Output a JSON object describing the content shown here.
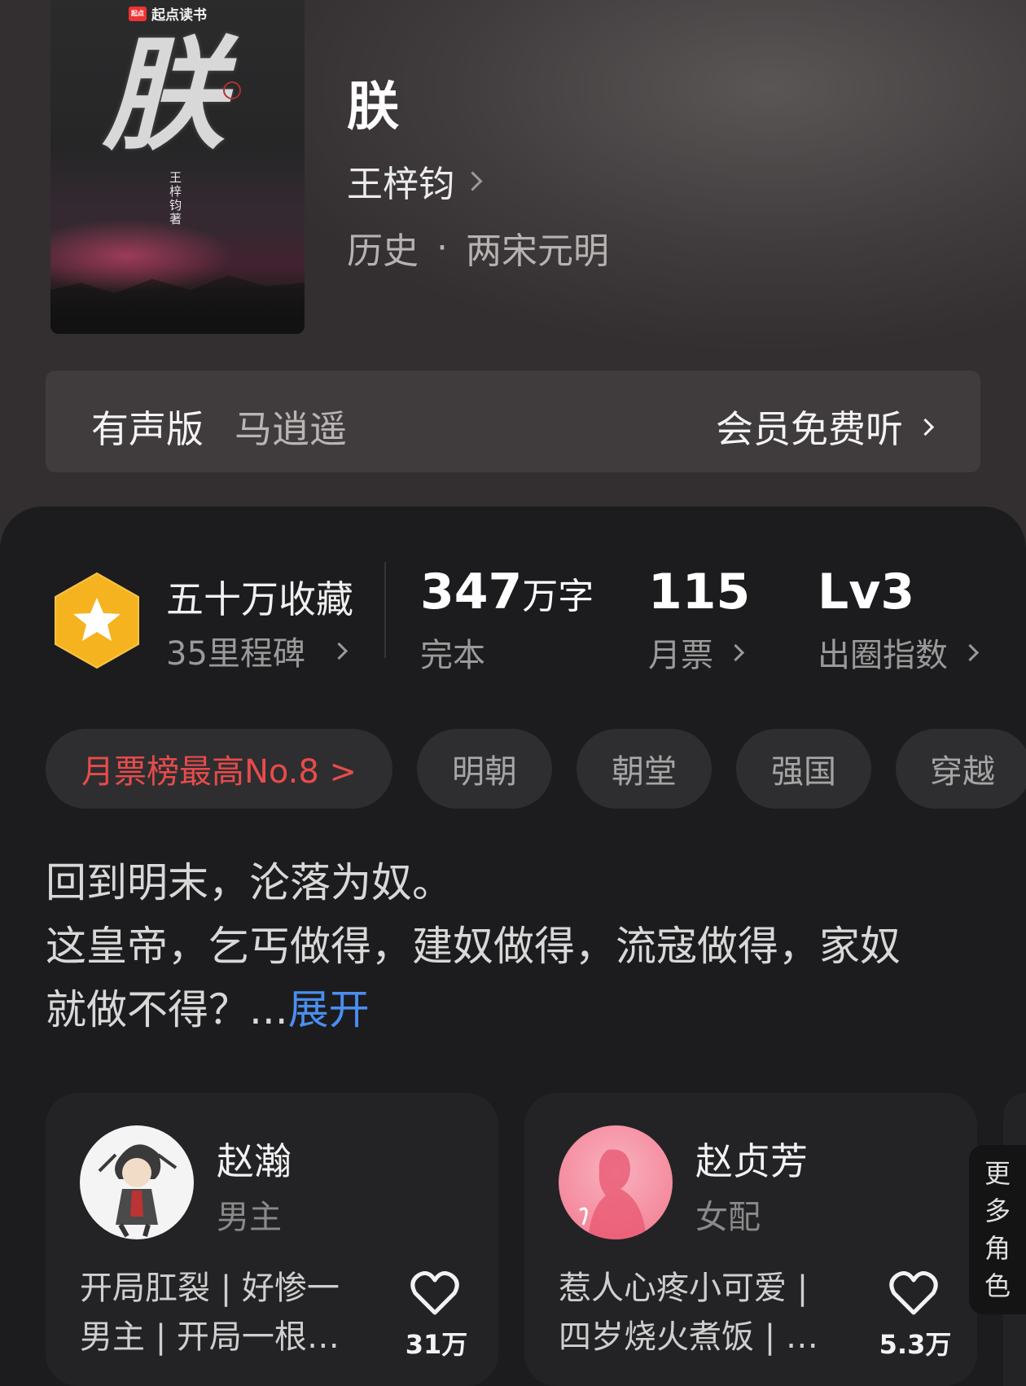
{
  "cover": {
    "brand": "起点读书",
    "brand_logo": "起点",
    "title": "朕",
    "author_vertical": "王梓钧著"
  },
  "book": {
    "title": "朕",
    "author": "王梓钧",
    "genre": "历史",
    "genre_separator": "·",
    "subgenre": "两宋元明"
  },
  "audio": {
    "label": "有声版",
    "narrator": "马逍遥",
    "cta": "会员免费听"
  },
  "stats": {
    "collect_title": "五十万收藏",
    "collect_sub": "35里程碑",
    "words_num": "347",
    "words_unit": "万字",
    "words_label": "完本",
    "tickets_num": "115",
    "tickets_label": "月票",
    "circle_num": "Lv3",
    "circle_label": "出圈指数"
  },
  "tags": [
    "月票榜最高No.8 >",
    "明朝",
    "朝堂",
    "强国",
    "穿越"
  ],
  "synopsis": {
    "line1": "回到明末，沦落为奴。",
    "line2": "这皇帝，乞丐做得，建奴做得，流寇做得，家奴",
    "line3": "就做不得？...",
    "expand": "展开"
  },
  "characters": [
    {
      "name": "赵瀚",
      "role": "男主",
      "desc1": "开局肛裂 | 好惨一",
      "desc2": "男主 | 开局一根…",
      "likes": "31万"
    },
    {
      "name": "赵贞芳",
      "role": "女配",
      "desc1": "惹人心疼小可爱 |",
      "desc2": "四岁烧火煮饭 | …",
      "likes": "5.3万"
    }
  ],
  "more_roles": "更多角色",
  "colors": {
    "accent_red": "#e84b4b",
    "link_blue": "#4a8ef0",
    "badge_gold": "#f6b320"
  }
}
